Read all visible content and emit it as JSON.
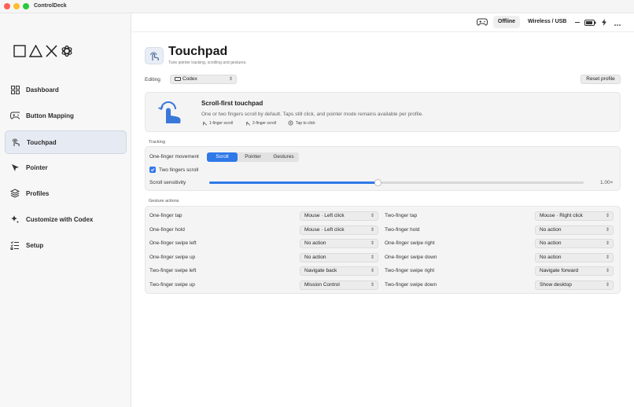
{
  "window": {
    "title": "ControlDeck"
  },
  "sidebar": {
    "items": [
      {
        "label": "Dashboard",
        "icon": "grid-icon"
      },
      {
        "label": "Button Mapping",
        "icon": "gamepad-icon"
      },
      {
        "label": "Touchpad",
        "icon": "touch-icon",
        "active": true
      },
      {
        "label": "Pointer",
        "icon": "cursor-icon"
      },
      {
        "label": "Profiles",
        "icon": "layers-icon"
      },
      {
        "label": "Customize with Codex",
        "icon": "sparkle-icon"
      },
      {
        "label": "Setup",
        "icon": "checklist-icon"
      }
    ]
  },
  "topbar": {
    "status": "Offline",
    "connection": "Wireless / USB",
    "icons": [
      "gamepad-icon",
      "minus-icon",
      "battery-icon",
      "bolt-icon",
      "more-icon"
    ]
  },
  "page": {
    "title": "Touchpad",
    "subtitle": "Tune pointer tracking, scrolling and gestures."
  },
  "editing": {
    "label": "Editing",
    "profile": "Codex",
    "reset_label": "Reset profile"
  },
  "hero": {
    "title": "Scroll-first touchpad",
    "description": "One or two fingers scroll by default. Taps still click, and pointer mode remains available per profile.",
    "chips": [
      "1-finger scroll",
      "2-finger scroll",
      "Tap to click"
    ]
  },
  "tracking": {
    "section_label": "Tracking",
    "movement_label": "One-finger movement",
    "modes": [
      "Scroll",
      "Pointer",
      "Gestures"
    ],
    "active_mode": "Scroll",
    "two_finger_label": "Two fingers scroll",
    "two_finger_checked": true,
    "sensitivity_label": "Scroll sensitivity",
    "sensitivity_fraction": 0.45,
    "sensitivity_value": "1.00×"
  },
  "gestures": {
    "section_label": "Gesture actions",
    "rows": [
      {
        "left_label": "One-finger tap",
        "left_value": "Mouse · Left click",
        "right_label": "Two-finger tap",
        "right_value": "Mouse · Right click"
      },
      {
        "left_label": "One-finger hold",
        "left_value": "Mouse · Left click",
        "right_label": "Two-finger hold",
        "right_value": "No action"
      },
      {
        "left_label": "One-finger swipe left",
        "left_value": "No action",
        "right_label": "One-finger swipe right",
        "right_value": "No action"
      },
      {
        "left_label": "One-finger swipe up",
        "left_value": "No action",
        "right_label": "One-finger swipe down",
        "right_value": "No action"
      },
      {
        "left_label": "Two-finger swipe left",
        "left_value": "Navigate back",
        "right_label": "Two-finger swipe right",
        "right_value": "Navigate forward"
      },
      {
        "left_label": "Two-finger swipe up",
        "left_value": "Mission Control",
        "right_label": "Two-finger swipe down",
        "right_value": "Show desktop"
      }
    ]
  },
  "colors": {
    "accent": "#2f78e8",
    "sidebar_active": "#e6ebf3"
  }
}
